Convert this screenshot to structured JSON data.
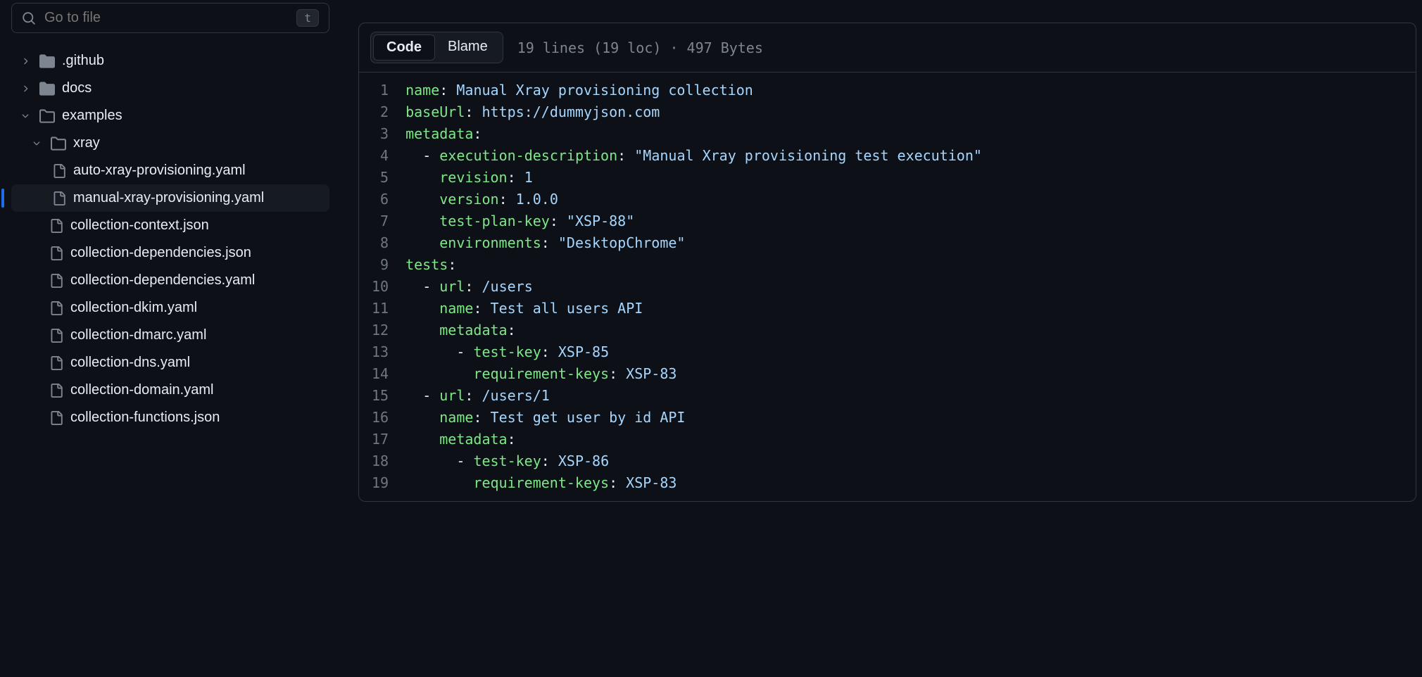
{
  "search": {
    "placeholder": "Go to file",
    "shortcut": "t"
  },
  "tree": {
    "github": ".github",
    "docs": "docs",
    "examples": "examples",
    "xray": "xray",
    "files": {
      "auto": "auto-xray-provisioning.yaml",
      "manual": "manual-xray-provisioning.yaml",
      "ctx": "collection-context.json",
      "depsjson": "collection-dependencies.json",
      "depsyaml": "collection-dependencies.yaml",
      "dkim": "collection-dkim.yaml",
      "dmarc": "collection-dmarc.yaml",
      "dns": "collection-dns.yaml",
      "domain": "collection-domain.yaml",
      "functions": "collection-functions.json"
    }
  },
  "viewer": {
    "tabs": {
      "code": "Code",
      "blame": "Blame"
    },
    "meta": "19 lines (19 loc) · 497 Bytes"
  },
  "code": {
    "l1": {
      "k": "name",
      "v": "Manual Xray provisioning collection"
    },
    "l2": {
      "k": "baseUrl",
      "v": "https://dummyjson.com"
    },
    "l3": {
      "k": "metadata"
    },
    "l4": {
      "k": "execution-description",
      "v": "\"Manual Xray provisioning test execution\""
    },
    "l5": {
      "k": "revision",
      "v": "1"
    },
    "l6": {
      "k": "version",
      "v": "1.0.0"
    },
    "l7": {
      "k": "test-plan-key",
      "v": "\"XSP-88\""
    },
    "l8": {
      "k": "environments",
      "v": "\"DesktopChrome\""
    },
    "l9": {
      "k": "tests"
    },
    "l10": {
      "k": "url",
      "v": "/users"
    },
    "l11": {
      "k": "name",
      "v": "Test all users API"
    },
    "l12": {
      "k": "metadata"
    },
    "l13": {
      "k": "test-key",
      "v": "XSP-85"
    },
    "l14": {
      "k": "requirement-keys",
      "v": "XSP-83"
    },
    "l15": {
      "k": "url",
      "v": "/users/1"
    },
    "l16": {
      "k": "name",
      "v": "Test get user by id API"
    },
    "l17": {
      "k": "metadata"
    },
    "l18": {
      "k": "test-key",
      "v": "XSP-86"
    },
    "l19": {
      "k": "requirement-keys",
      "v": "XSP-83"
    }
  },
  "lineNumbers": [
    "1",
    "2",
    "3",
    "4",
    "5",
    "6",
    "7",
    "8",
    "9",
    "10",
    "11",
    "12",
    "13",
    "14",
    "15",
    "16",
    "17",
    "18",
    "19"
  ]
}
